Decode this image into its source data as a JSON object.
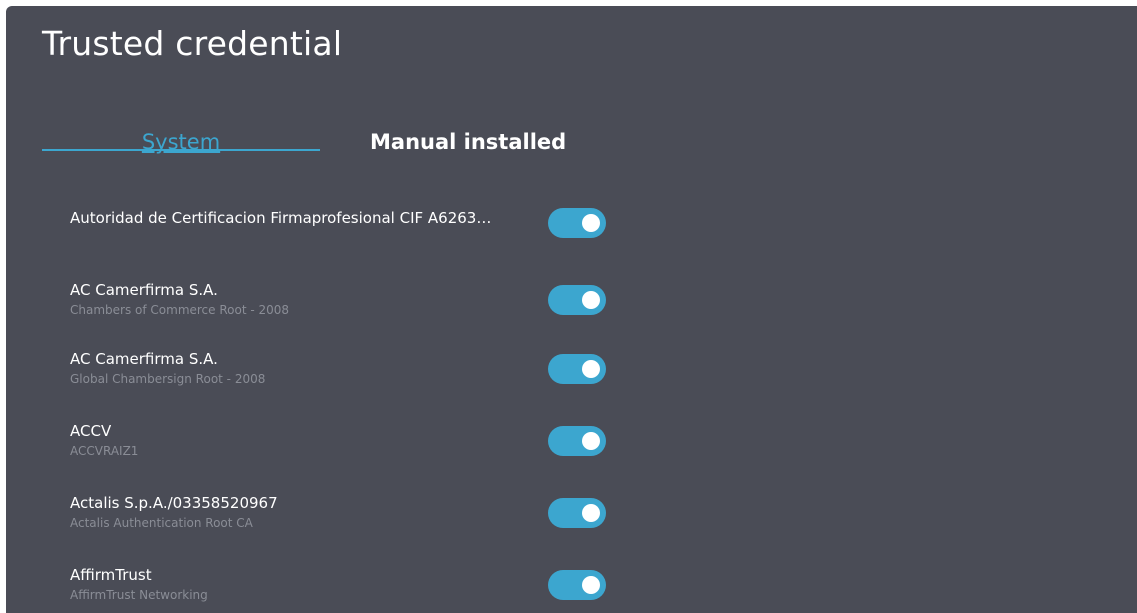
{
  "header": {
    "title": "Trusted credential"
  },
  "tabs": [
    {
      "label": "System",
      "active": true
    },
    {
      "label": "Manual installed",
      "active": false
    }
  ],
  "colors": {
    "accent": "#3ca6cf",
    "panel_bg": "#4a4c56",
    "subtitle": "#8a8d96"
  },
  "credentials": [
    {
      "title": "Autoridad de Certificacion Firmaprofesional CIF A6263…",
      "subtitle": "",
      "enabled": true
    },
    {
      "title": "AC Camerfirma S.A.",
      "subtitle": "Chambers of Commerce Root - 2008",
      "enabled": true
    },
    {
      "title": "AC Camerfirma S.A.",
      "subtitle": "Global Chambersign Root - 2008",
      "enabled": true
    },
    {
      "title": "ACCV",
      "subtitle": "ACCVRAIZ1",
      "enabled": true
    },
    {
      "title": "Actalis S.p.A./03358520967",
      "subtitle": "Actalis Authentication Root CA",
      "enabled": true
    },
    {
      "title": "AffirmTrust",
      "subtitle": "AffirmTrust Networking",
      "enabled": true
    }
  ]
}
